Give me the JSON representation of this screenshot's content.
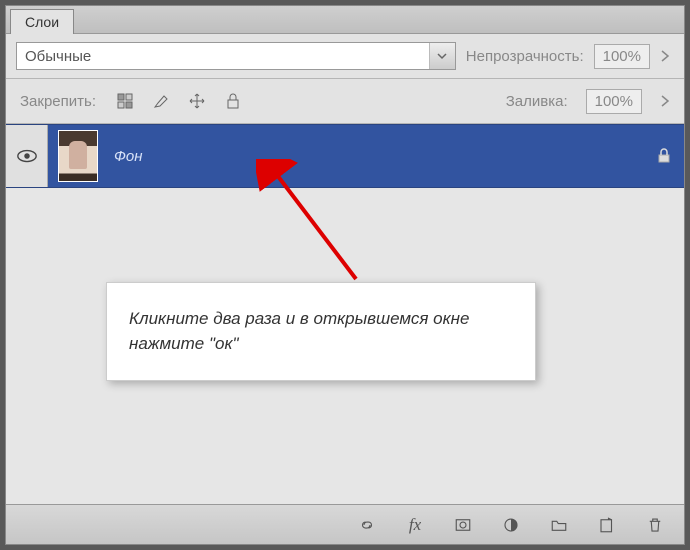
{
  "panel": {
    "tab": "Слои"
  },
  "options": {
    "blend_mode": "Обычные",
    "opacity_label": "Непрозрачность:",
    "opacity_value": "100%",
    "lock_label": "Закрепить:",
    "fill_label": "Заливка:",
    "fill_value": "100%"
  },
  "layer": {
    "name": "Фон"
  },
  "callout": {
    "text": "Кликните два раза и в открывшемся окне нажмите \"ок\""
  },
  "footer": {
    "buttons": [
      "link",
      "fx",
      "mask",
      "adjust",
      "group",
      "new",
      "delete"
    ]
  }
}
